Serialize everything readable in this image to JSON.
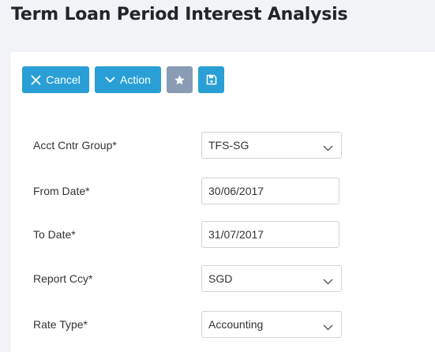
{
  "page": {
    "title": "Term Loan Period Interest Analysis"
  },
  "toolbar": {
    "cancel_label": "Cancel",
    "action_label": "Action",
    "favorite_icon": "star-icon",
    "save_icon": "save-icon"
  },
  "form": {
    "acct_cntr_group": {
      "label": "Acct Cntr Group*",
      "value": "TFS-SG"
    },
    "from_date": {
      "label": "From Date*",
      "value": "30/06/2017"
    },
    "to_date": {
      "label": "To Date*",
      "value": "31/07/2017"
    },
    "report_ccy": {
      "label": "Report Ccy*",
      "value": "SGD"
    },
    "rate_type": {
      "label": "Rate Type*",
      "value": "Accounting"
    }
  },
  "colors": {
    "primary": "#2a9fd6",
    "secondary": "#8a9bb5",
    "background": "#f1f3f6"
  }
}
